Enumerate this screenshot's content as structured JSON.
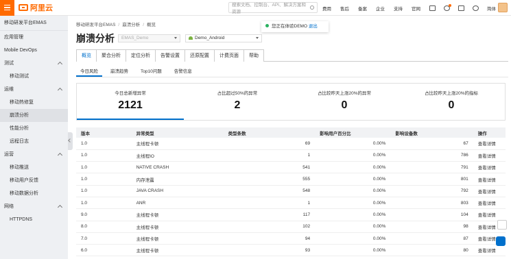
{
  "brand": {
    "name": "阿里云"
  },
  "search": {
    "placeholder": "搜索文档、控制台、API、解决方案和资源"
  },
  "topnav": {
    "items": [
      "费用",
      "售后",
      "备案",
      "企业",
      "支持",
      "官网"
    ],
    "lang": "简体"
  },
  "sidebar": {
    "title": "移动研发平台EMAS",
    "items": [
      {
        "label": "应用管理",
        "type": "group"
      },
      {
        "label": "Mobile DevOps",
        "type": "group"
      },
      {
        "label": "测试",
        "type": "group",
        "chev": true
      },
      {
        "label": "移动测试",
        "type": "sub"
      },
      {
        "label": "运维",
        "type": "group",
        "chev": true
      },
      {
        "label": "移动热修复",
        "type": "sub"
      },
      {
        "label": "崩溃分析",
        "type": "sub",
        "active": true
      },
      {
        "label": "性能分析",
        "type": "sub"
      },
      {
        "label": "远程日志",
        "type": "sub"
      },
      {
        "label": "运营",
        "type": "group",
        "chev": true
      },
      {
        "label": "移动推送",
        "type": "sub"
      },
      {
        "label": "移动用户反馈",
        "type": "sub"
      },
      {
        "label": "移动数据分析",
        "type": "sub"
      },
      {
        "label": "网络",
        "type": "group",
        "chev": true
      },
      {
        "label": "HTTPDNS",
        "type": "sub"
      }
    ]
  },
  "breadcrumb": [
    "移动研发平台EMAS",
    "崩溃分析",
    "概览"
  ],
  "page": {
    "title": "崩溃分析",
    "select_app": "EMAS_Demo",
    "select_platform": "Demo_Android"
  },
  "toast": {
    "text": "您正在体验DEMO",
    "action": "退出"
  },
  "tabs": [
    "概览",
    "聚合分析",
    "定位分析",
    "告警设置",
    "还原配置",
    "计费页面",
    "帮助"
  ],
  "subtabs": [
    "今日风险",
    "崩溃趋势",
    "Top10问题",
    "告警信息"
  ],
  "stats": [
    {
      "label": "今日总新增异常",
      "value": "2121"
    },
    {
      "label": "占比超过50%的异常",
      "value": "2"
    },
    {
      "label": "占比较昨天上涨20%的异常",
      "value": "0"
    },
    {
      "label": "占比较昨天上涨20%的指标",
      "value": "0"
    }
  ],
  "table": {
    "headers": [
      "版本",
      "异常类型",
      "类型条数",
      "影响用户百分比",
      "影响设备数",
      "操作"
    ],
    "rows": [
      [
        "1.0",
        "主线程卡顿",
        "69",
        "0.00%",
        "67",
        "查看详情"
      ],
      [
        "1.0",
        "主线程IO",
        "1",
        "0.00%",
        "786",
        "查看详情"
      ],
      [
        "1.0",
        "NATIVE CRASH",
        "541",
        "0.00%",
        "791",
        "查看详情"
      ],
      [
        "1.0",
        "内存泄露",
        "555",
        "0.00%",
        "801",
        "查看详情"
      ],
      [
        "1.0",
        "JAVA CRASH",
        "548",
        "0.00%",
        "792",
        "查看详情"
      ],
      [
        "1.0",
        "ANR",
        "1",
        "0.00%",
        "803",
        "查看详情"
      ],
      [
        "9.0",
        "主线程卡顿",
        "117",
        "0.00%",
        "104",
        "查看详情"
      ],
      [
        "8.0",
        "主线程卡顿",
        "102",
        "0.00%",
        "98",
        "查看详情"
      ],
      [
        "7.0",
        "主线程卡顿",
        "94",
        "0.00%",
        "87",
        "查看详情"
      ],
      [
        "6.0",
        "主线程卡顿",
        "93",
        "0.00%",
        "80",
        "查看详情"
      ]
    ]
  }
}
